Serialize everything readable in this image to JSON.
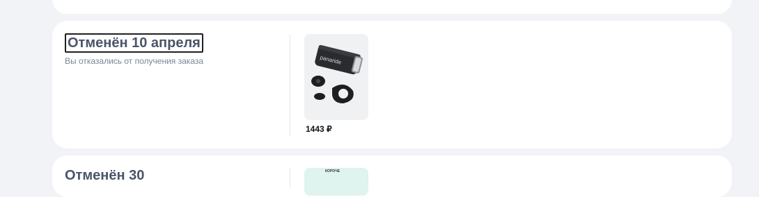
{
  "orders": [
    {
      "status_title": "Отменён 10 апреля",
      "status_subtitle": "Вы отказались от получения заказа",
      "product": {
        "brand_text": "panaride",
        "image_icon": "bike-light-product-image",
        "price": "1443 ₽"
      }
    },
    {
      "status_title": "Отменён 30",
      "badge_text": "КОРОЧЕ"
    }
  ]
}
